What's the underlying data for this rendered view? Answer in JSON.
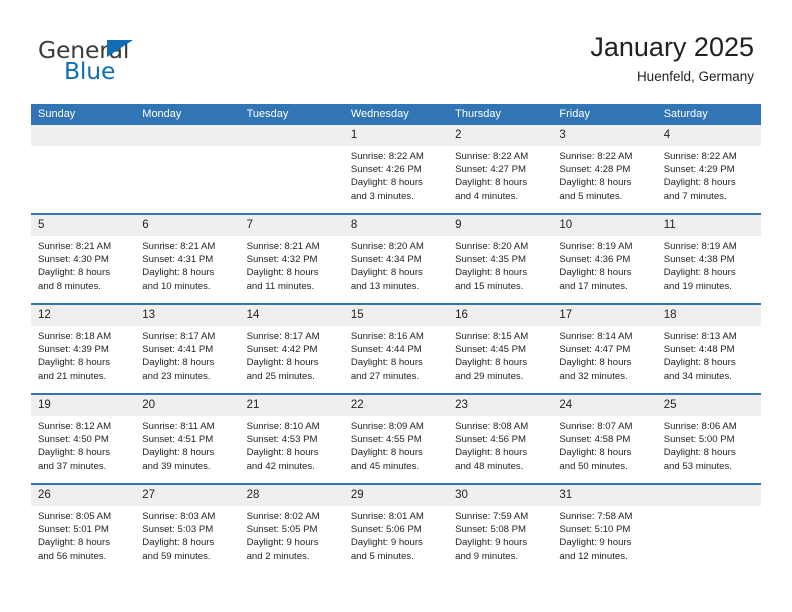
{
  "brand": {
    "name_part1": "General",
    "name_part2": "Blue",
    "accent_color": "#0f6cb5"
  },
  "header": {
    "title": "January 2025",
    "location": "Huenfeld, Germany",
    "header_bg_color": "#3175b4",
    "daynum_bg_color": "#efefef"
  },
  "weekdays": [
    "Sunday",
    "Monday",
    "Tuesday",
    "Wednesday",
    "Thursday",
    "Friday",
    "Saturday"
  ],
  "weeks": [
    [
      {
        "day": "",
        "sunrise": "",
        "sunset": "",
        "daylight_line1": "",
        "daylight_line2": ""
      },
      {
        "day": "",
        "sunrise": "",
        "sunset": "",
        "daylight_line1": "",
        "daylight_line2": ""
      },
      {
        "day": "",
        "sunrise": "",
        "sunset": "",
        "daylight_line1": "",
        "daylight_line2": ""
      },
      {
        "day": "1",
        "sunrise": "Sunrise: 8:22 AM",
        "sunset": "Sunset: 4:26 PM",
        "daylight_line1": "Daylight: 8 hours",
        "daylight_line2": "and 3 minutes."
      },
      {
        "day": "2",
        "sunrise": "Sunrise: 8:22 AM",
        "sunset": "Sunset: 4:27 PM",
        "daylight_line1": "Daylight: 8 hours",
        "daylight_line2": "and 4 minutes."
      },
      {
        "day": "3",
        "sunrise": "Sunrise: 8:22 AM",
        "sunset": "Sunset: 4:28 PM",
        "daylight_line1": "Daylight: 8 hours",
        "daylight_line2": "and 5 minutes."
      },
      {
        "day": "4",
        "sunrise": "Sunrise: 8:22 AM",
        "sunset": "Sunset: 4:29 PM",
        "daylight_line1": "Daylight: 8 hours",
        "daylight_line2": "and 7 minutes."
      }
    ],
    [
      {
        "day": "5",
        "sunrise": "Sunrise: 8:21 AM",
        "sunset": "Sunset: 4:30 PM",
        "daylight_line1": "Daylight: 8 hours",
        "daylight_line2": "and 8 minutes."
      },
      {
        "day": "6",
        "sunrise": "Sunrise: 8:21 AM",
        "sunset": "Sunset: 4:31 PM",
        "daylight_line1": "Daylight: 8 hours",
        "daylight_line2": "and 10 minutes."
      },
      {
        "day": "7",
        "sunrise": "Sunrise: 8:21 AM",
        "sunset": "Sunset: 4:32 PM",
        "daylight_line1": "Daylight: 8 hours",
        "daylight_line2": "and 11 minutes."
      },
      {
        "day": "8",
        "sunrise": "Sunrise: 8:20 AM",
        "sunset": "Sunset: 4:34 PM",
        "daylight_line1": "Daylight: 8 hours",
        "daylight_line2": "and 13 minutes."
      },
      {
        "day": "9",
        "sunrise": "Sunrise: 8:20 AM",
        "sunset": "Sunset: 4:35 PM",
        "daylight_line1": "Daylight: 8 hours",
        "daylight_line2": "and 15 minutes."
      },
      {
        "day": "10",
        "sunrise": "Sunrise: 8:19 AM",
        "sunset": "Sunset: 4:36 PM",
        "daylight_line1": "Daylight: 8 hours",
        "daylight_line2": "and 17 minutes."
      },
      {
        "day": "11",
        "sunrise": "Sunrise: 8:19 AM",
        "sunset": "Sunset: 4:38 PM",
        "daylight_line1": "Daylight: 8 hours",
        "daylight_line2": "and 19 minutes."
      }
    ],
    [
      {
        "day": "12",
        "sunrise": "Sunrise: 8:18 AM",
        "sunset": "Sunset: 4:39 PM",
        "daylight_line1": "Daylight: 8 hours",
        "daylight_line2": "and 21 minutes."
      },
      {
        "day": "13",
        "sunrise": "Sunrise: 8:17 AM",
        "sunset": "Sunset: 4:41 PM",
        "daylight_line1": "Daylight: 8 hours",
        "daylight_line2": "and 23 minutes."
      },
      {
        "day": "14",
        "sunrise": "Sunrise: 8:17 AM",
        "sunset": "Sunset: 4:42 PM",
        "daylight_line1": "Daylight: 8 hours",
        "daylight_line2": "and 25 minutes."
      },
      {
        "day": "15",
        "sunrise": "Sunrise: 8:16 AM",
        "sunset": "Sunset: 4:44 PM",
        "daylight_line1": "Daylight: 8 hours",
        "daylight_line2": "and 27 minutes."
      },
      {
        "day": "16",
        "sunrise": "Sunrise: 8:15 AM",
        "sunset": "Sunset: 4:45 PM",
        "daylight_line1": "Daylight: 8 hours",
        "daylight_line2": "and 29 minutes."
      },
      {
        "day": "17",
        "sunrise": "Sunrise: 8:14 AM",
        "sunset": "Sunset: 4:47 PM",
        "daylight_line1": "Daylight: 8 hours",
        "daylight_line2": "and 32 minutes."
      },
      {
        "day": "18",
        "sunrise": "Sunrise: 8:13 AM",
        "sunset": "Sunset: 4:48 PM",
        "daylight_line1": "Daylight: 8 hours",
        "daylight_line2": "and 34 minutes."
      }
    ],
    [
      {
        "day": "19",
        "sunrise": "Sunrise: 8:12 AM",
        "sunset": "Sunset: 4:50 PM",
        "daylight_line1": "Daylight: 8 hours",
        "daylight_line2": "and 37 minutes."
      },
      {
        "day": "20",
        "sunrise": "Sunrise: 8:11 AM",
        "sunset": "Sunset: 4:51 PM",
        "daylight_line1": "Daylight: 8 hours",
        "daylight_line2": "and 39 minutes."
      },
      {
        "day": "21",
        "sunrise": "Sunrise: 8:10 AM",
        "sunset": "Sunset: 4:53 PM",
        "daylight_line1": "Daylight: 8 hours",
        "daylight_line2": "and 42 minutes."
      },
      {
        "day": "22",
        "sunrise": "Sunrise: 8:09 AM",
        "sunset": "Sunset: 4:55 PM",
        "daylight_line1": "Daylight: 8 hours",
        "daylight_line2": "and 45 minutes."
      },
      {
        "day": "23",
        "sunrise": "Sunrise: 8:08 AM",
        "sunset": "Sunset: 4:56 PM",
        "daylight_line1": "Daylight: 8 hours",
        "daylight_line2": "and 48 minutes."
      },
      {
        "day": "24",
        "sunrise": "Sunrise: 8:07 AM",
        "sunset": "Sunset: 4:58 PM",
        "daylight_line1": "Daylight: 8 hours",
        "daylight_line2": "and 50 minutes."
      },
      {
        "day": "25",
        "sunrise": "Sunrise: 8:06 AM",
        "sunset": "Sunset: 5:00 PM",
        "daylight_line1": "Daylight: 8 hours",
        "daylight_line2": "and 53 minutes."
      }
    ],
    [
      {
        "day": "26",
        "sunrise": "Sunrise: 8:05 AM",
        "sunset": "Sunset: 5:01 PM",
        "daylight_line1": "Daylight: 8 hours",
        "daylight_line2": "and 56 minutes."
      },
      {
        "day": "27",
        "sunrise": "Sunrise: 8:03 AM",
        "sunset": "Sunset: 5:03 PM",
        "daylight_line1": "Daylight: 8 hours",
        "daylight_line2": "and 59 minutes."
      },
      {
        "day": "28",
        "sunrise": "Sunrise: 8:02 AM",
        "sunset": "Sunset: 5:05 PM",
        "daylight_line1": "Daylight: 9 hours",
        "daylight_line2": "and 2 minutes."
      },
      {
        "day": "29",
        "sunrise": "Sunrise: 8:01 AM",
        "sunset": "Sunset: 5:06 PM",
        "daylight_line1": "Daylight: 9 hours",
        "daylight_line2": "and 5 minutes."
      },
      {
        "day": "30",
        "sunrise": "Sunrise: 7:59 AM",
        "sunset": "Sunset: 5:08 PM",
        "daylight_line1": "Daylight: 9 hours",
        "daylight_line2": "and 9 minutes."
      },
      {
        "day": "31",
        "sunrise": "Sunrise: 7:58 AM",
        "sunset": "Sunset: 5:10 PM",
        "daylight_line1": "Daylight: 9 hours",
        "daylight_line2": "and 12 minutes."
      },
      {
        "day": "",
        "sunrise": "",
        "sunset": "",
        "daylight_line1": "",
        "daylight_line2": ""
      }
    ]
  ]
}
